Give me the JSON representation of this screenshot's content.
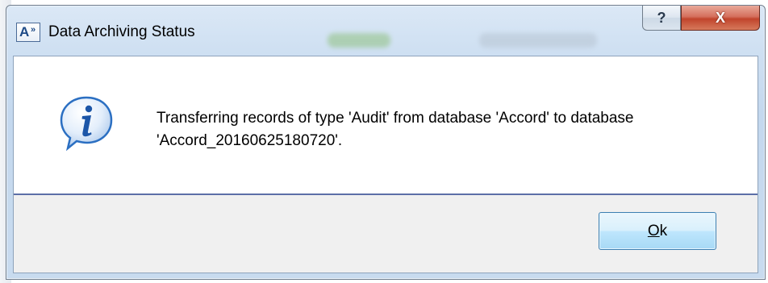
{
  "window": {
    "title": "Data Archiving Status",
    "icon_letter": "A",
    "icon_suffix": "»",
    "help_glyph": "?",
    "close_glyph": "X"
  },
  "dialog": {
    "icon": "info-icon",
    "message": "Transferring records of type 'Audit' from database 'Accord' to database 'Accord_20160625180720'."
  },
  "buttons": {
    "ok_mnemonic": "O",
    "ok_rest": "k"
  },
  "colors": {
    "close_button": "#c1442c",
    "info_icon": "#2b6fc2",
    "separator": "#5c6fa7",
    "ok_border": "#3c7fb1"
  }
}
